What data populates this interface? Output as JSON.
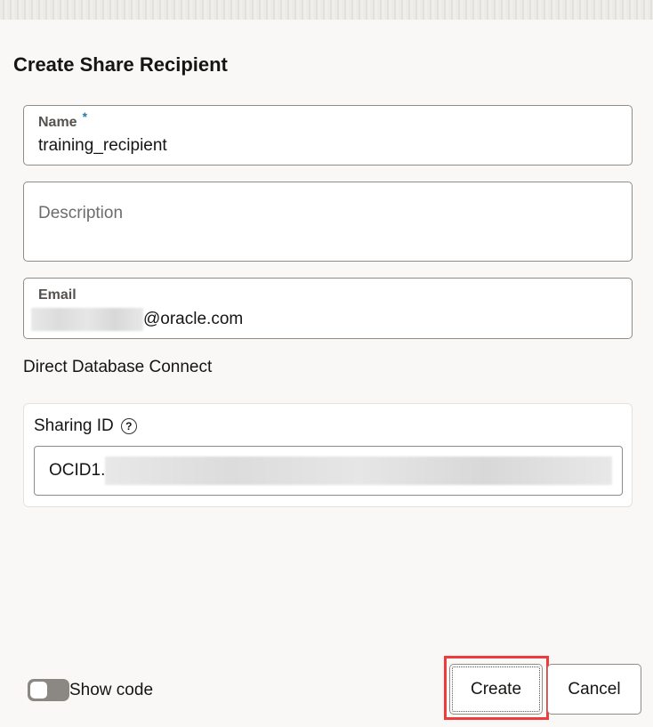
{
  "dialog": {
    "title": "Create Share Recipient"
  },
  "fields": {
    "name": {
      "label": "Name",
      "required_marker": "*",
      "value": "training_recipient"
    },
    "description": {
      "placeholder": "Description"
    },
    "email": {
      "label": "Email",
      "value_visible": "@oracle.com"
    }
  },
  "direct_connect": {
    "heading": "Direct Database Connect",
    "sharing_id": {
      "label": "Sharing ID",
      "help_icon": "?",
      "value_visible": "OCID1."
    }
  },
  "footer": {
    "show_code_label": "Show code",
    "create_label": "Create",
    "cancel_label": "Cancel"
  }
}
